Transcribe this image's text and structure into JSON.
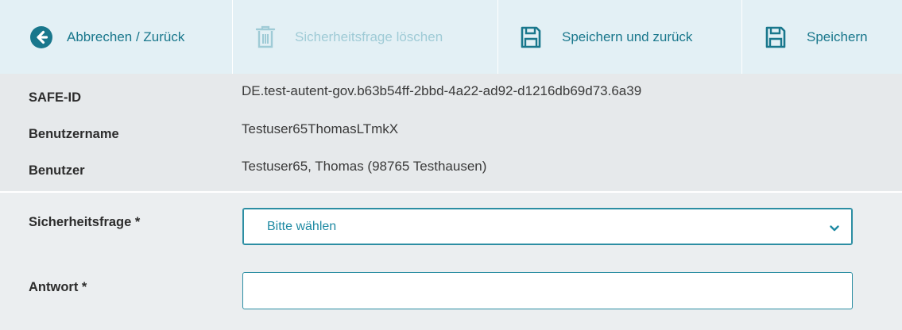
{
  "toolbar": {
    "back_label": "Abbrechen / Zurück",
    "delete_label": "Sicherheitsfrage löschen",
    "save_back_label": "Speichern und zurück",
    "save_label": "Speichern",
    "icons": {
      "back": "arrow-left-circle-icon",
      "delete": "trash-icon",
      "save_back": "floppy-disk-icon",
      "save": "floppy-disk-icon"
    },
    "colors": {
      "accent": "#19778c",
      "disabled": "#9fcbd6"
    }
  },
  "info": {
    "safe_id_label": "SAFE-ID",
    "safe_id_value": "DE.test-autent-gov.b63b54ff-2bbd-4a22-ad92-d1216db69d73.6a39",
    "username_label": "Benutzername",
    "username_value": "Testuser65ThomasLTmkX",
    "user_label": "Benutzer",
    "user_value": "Testuser65, Thomas (98765 Testhausen)"
  },
  "form": {
    "question_label": "Sicherheitsfrage *",
    "question_selected": "Bitte wählen",
    "answer_label": "Antwort *",
    "answer_value": ""
  }
}
